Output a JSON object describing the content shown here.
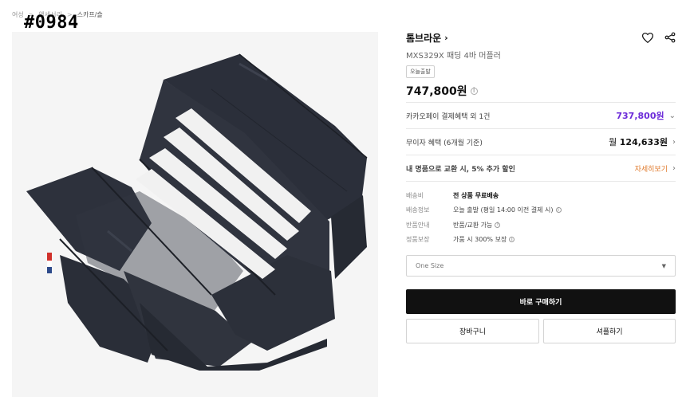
{
  "overlay": {
    "tag": "#0984"
  },
  "breadcrumb": {
    "items": [
      "여성",
      "액세서리",
      "스카프/숄"
    ]
  },
  "product": {
    "brand": "톰브라운",
    "name": "MXS329X 패딩 4바 머플러",
    "badge": "오늘출발",
    "price": "747,800원"
  },
  "benefits": {
    "kakao": {
      "label": "카카오페이 결제혜택 외 1건",
      "price": "737,800원"
    },
    "installment": {
      "label": "무이자 혜택 (6개월 기준)",
      "prefix": "월",
      "amount": "124,633원"
    },
    "exchange": {
      "label": "내 명품으로 교환 시, 5% 추가 할인",
      "link": "자세히보기"
    }
  },
  "shipping": {
    "rows": [
      {
        "key": "배송비",
        "value": "전 상품 무료배송"
      },
      {
        "key": "배송정보",
        "value": "오늘 출발 (평일 14:00 이전 결제 시)"
      },
      {
        "key": "반품안내",
        "value": "반품/교환 가능"
      },
      {
        "key": "정품보장",
        "value": "가품 시 300% 보장"
      }
    ]
  },
  "option": {
    "selected": "One Size"
  },
  "buttons": {
    "buy_now": "바로 구매하기",
    "cart": "장바구니",
    "sample": "셔플하기"
  },
  "colors": {
    "kakao_accent": "#6c2bd9",
    "exchange_accent": "#e07a2c",
    "primary_button": "#111111",
    "product_navy": "#2b2f3a"
  }
}
